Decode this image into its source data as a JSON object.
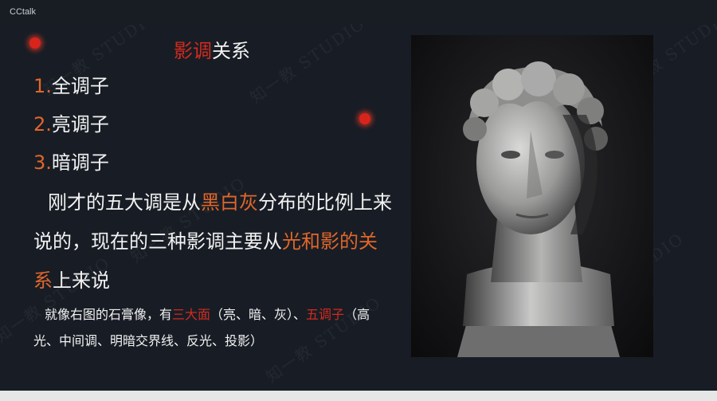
{
  "window": {
    "title": "CCtalk"
  },
  "slide": {
    "title_accent": "影调",
    "title_rest": "关系",
    "list": [
      {
        "num": "1.",
        "text": "全调子"
      },
      {
        "num": "2.",
        "text": "亮调子"
      },
      {
        "num": "3.",
        "text": "暗调子"
      }
    ],
    "para": {
      "part1": "刚才的五大调是从",
      "hl1": "黑白灰",
      "part2": "分布的比例上来说的，现在的三种影调主要从",
      "hl2": "光和影的关系",
      "part3": "上来说"
    },
    "note": {
      "part1": "就像右图的石膏像，有",
      "hl1": "三大面",
      "part2": "（亮、暗、灰）、",
      "hl2": "五调子",
      "part3": "（高光、中间调、明暗交界线、反光、投影）"
    },
    "watermark_text": "知一教 STUDIO",
    "image": {
      "subject": "plaster-bust-photo",
      "caption": ""
    }
  },
  "colors": {
    "background": "#181d25",
    "accent_red": "#d32a1e",
    "accent_orange": "#e0662a",
    "text": "#f2f2f2"
  }
}
